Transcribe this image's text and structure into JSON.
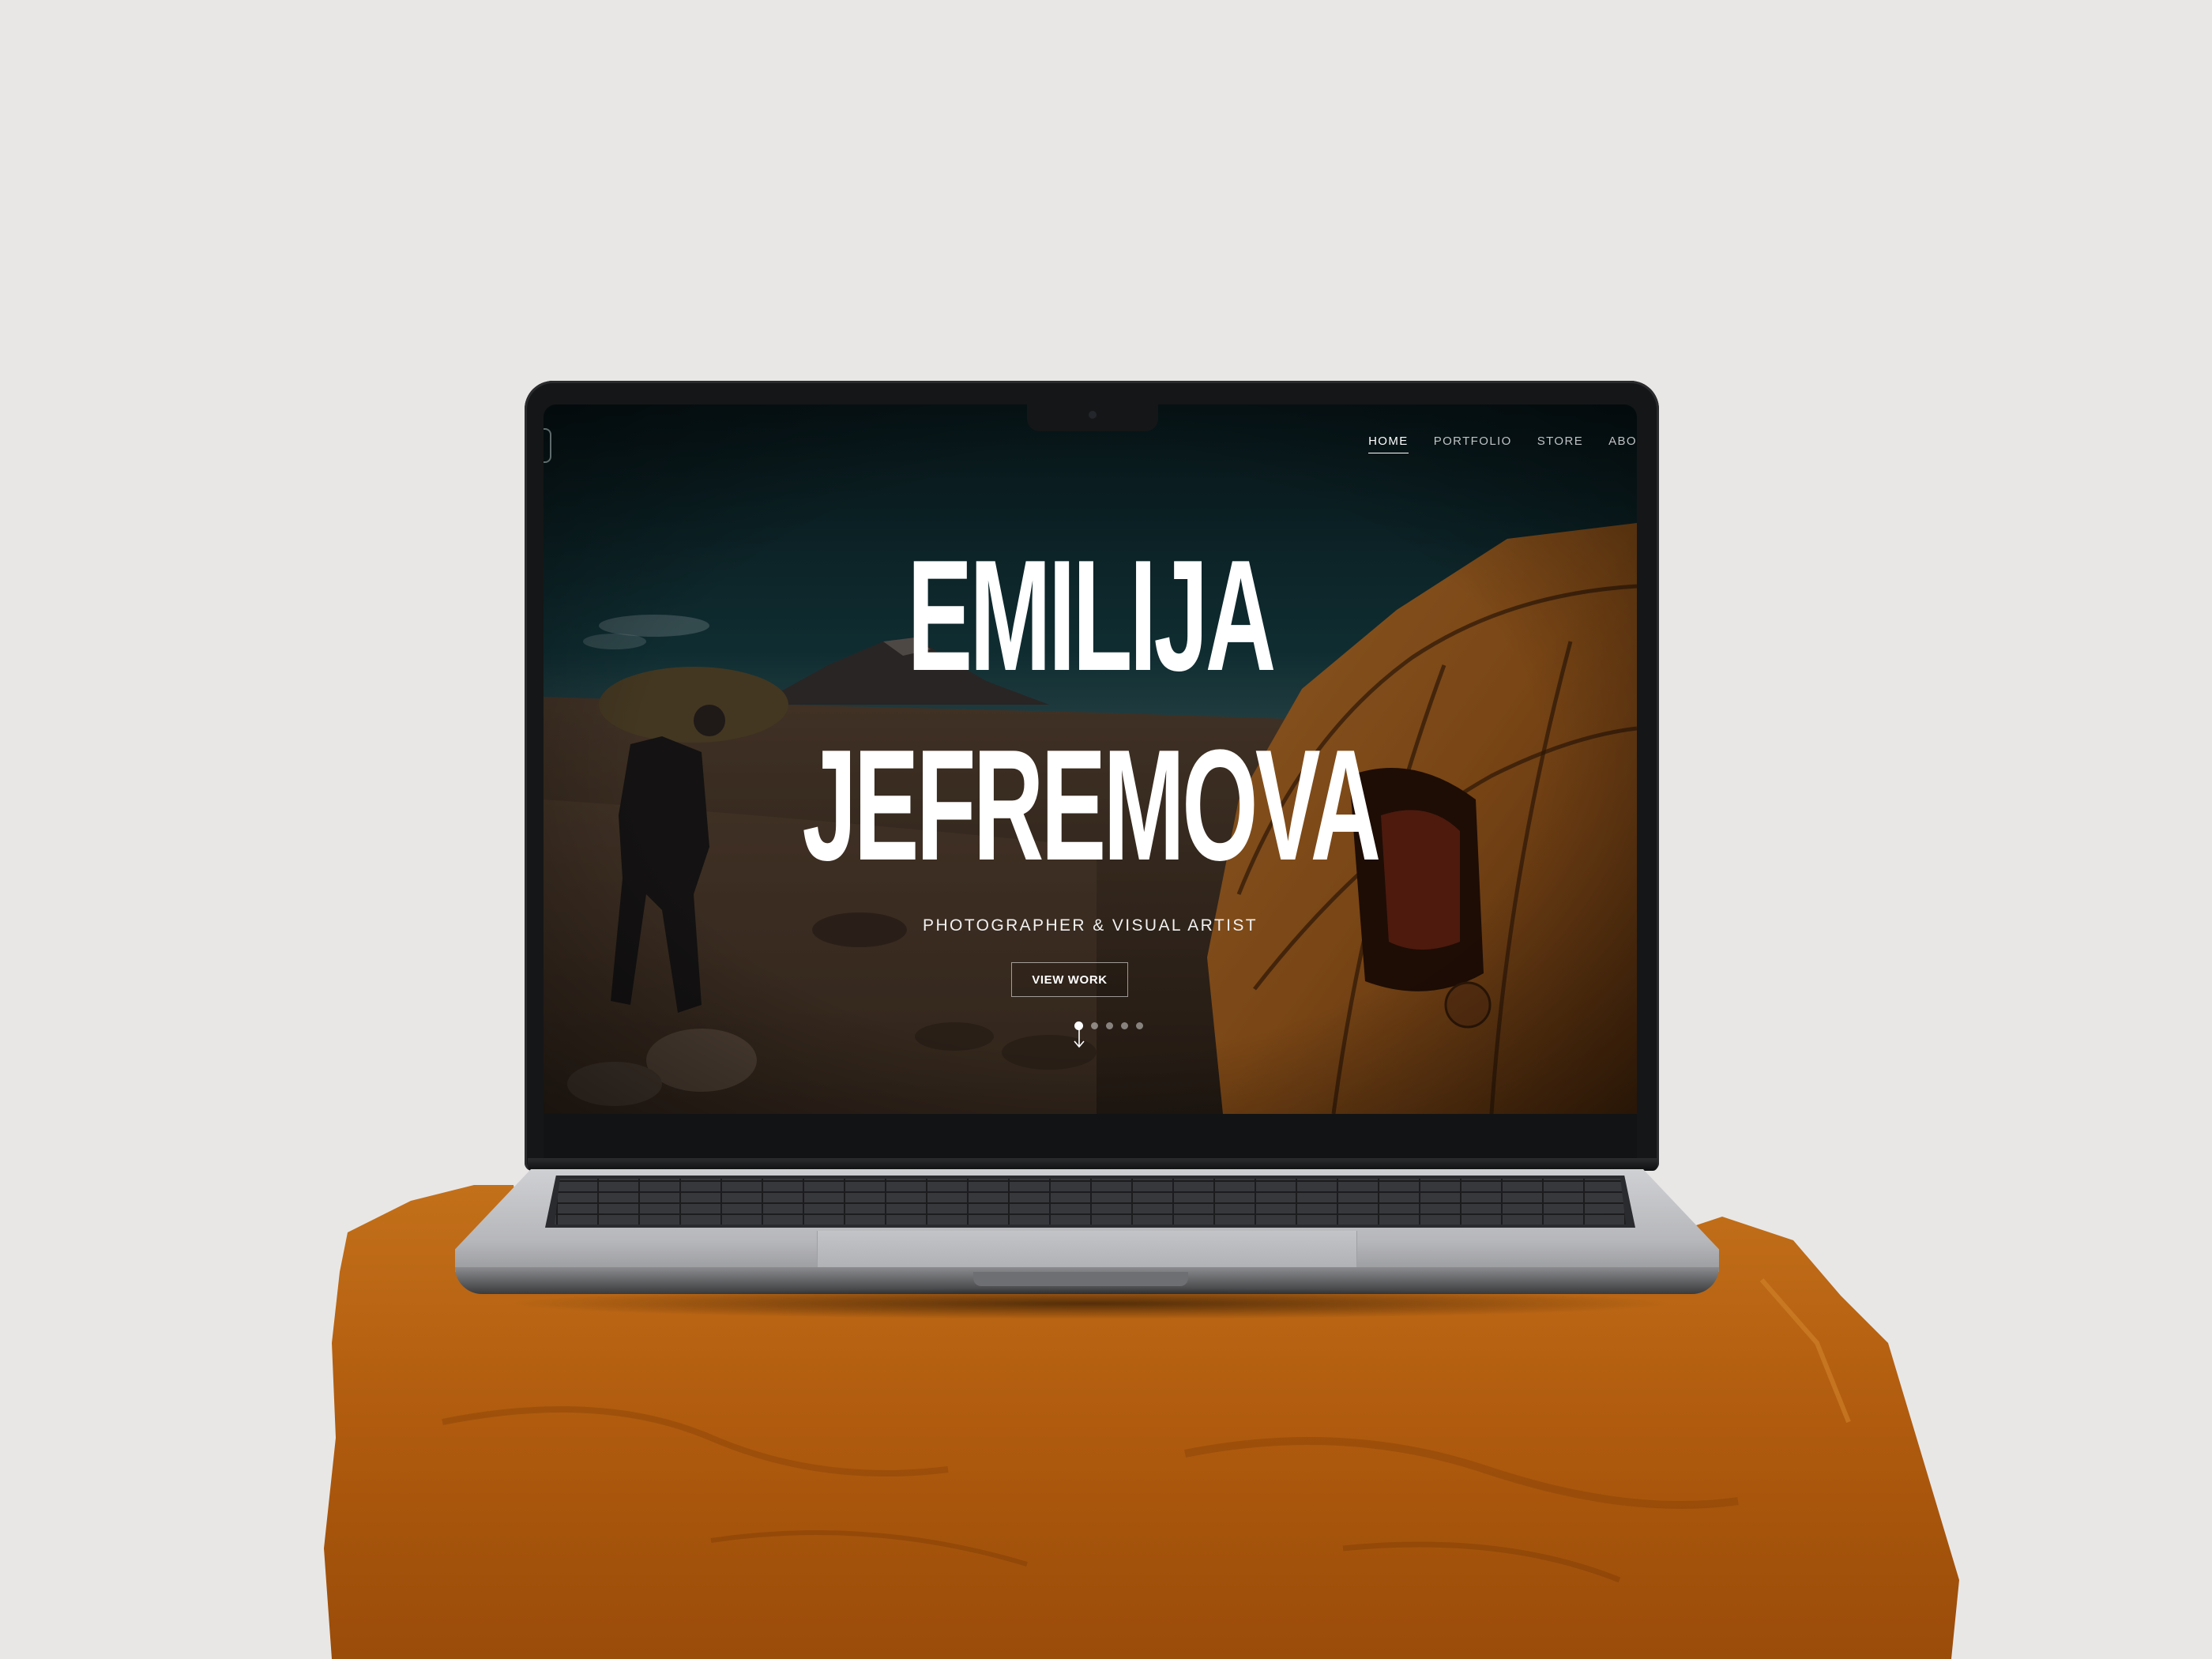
{
  "nav": {
    "items": [
      {
        "label": "HOME",
        "active": true
      },
      {
        "label": "PORTFOLIO",
        "active": false
      },
      {
        "label": "STORE",
        "active": false
      },
      {
        "label": "ABO",
        "active": false
      }
    ]
  },
  "hero": {
    "title_line1": "EMILIJA",
    "title_line2": "JEFREMOVA",
    "subtitle": "PHOTOGRAPHER & VISUAL ARTIST",
    "cta_label": "VIEW WORK",
    "slides": {
      "count": 5,
      "active_index": 0
    }
  },
  "colors": {
    "background": "#e8e7e6",
    "rock": "#b5600f",
    "laptop_frame": "#151617",
    "text_primary": "#ffffff"
  }
}
